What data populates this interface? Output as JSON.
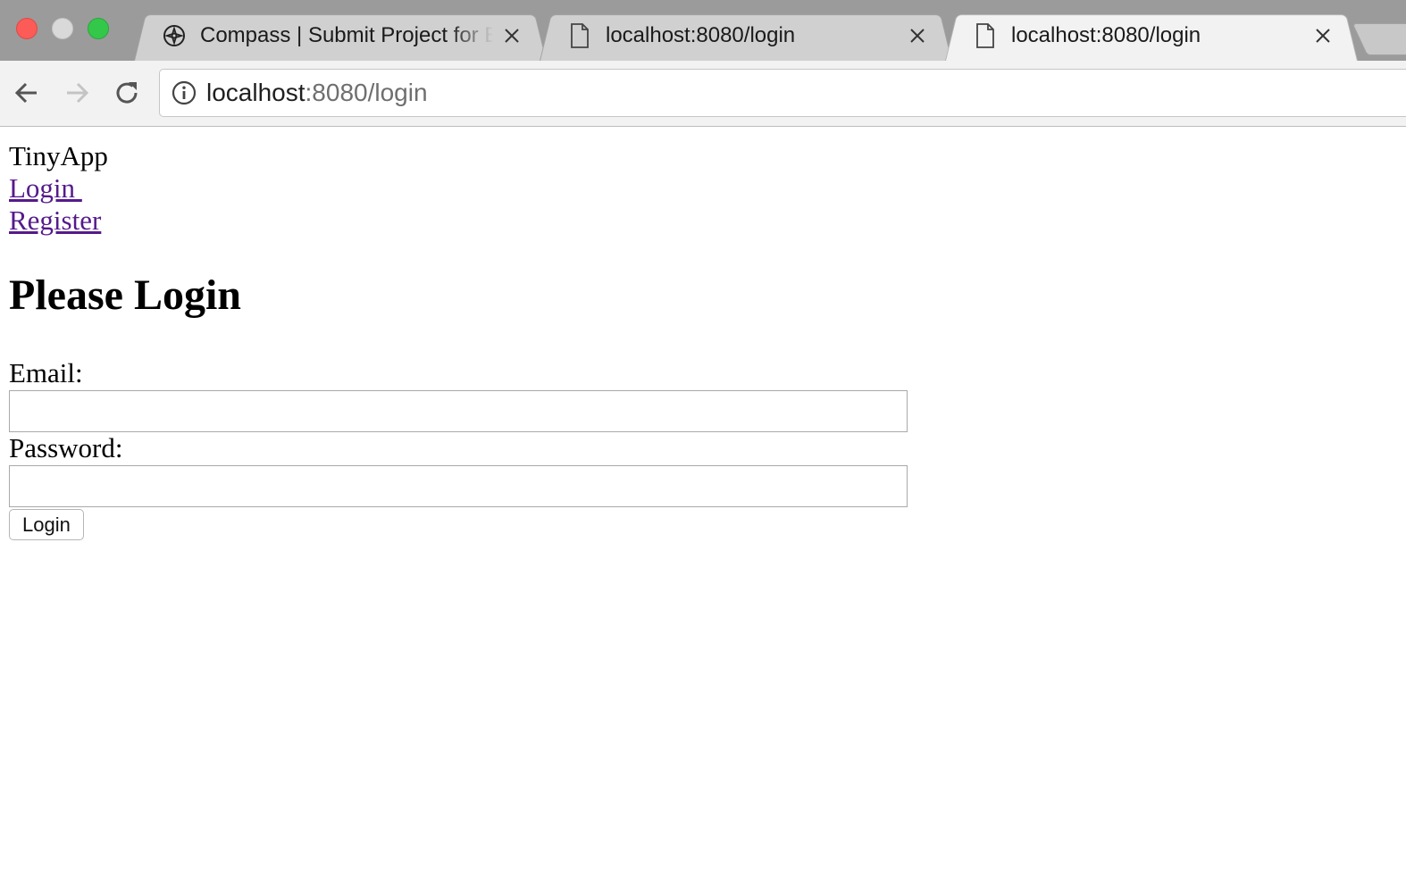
{
  "browser": {
    "tabs": [
      {
        "title": "Compass | Submit Project for E",
        "icon": "compass-icon",
        "active": false
      },
      {
        "title": "localhost:8080/login",
        "icon": "page-icon",
        "active": false
      },
      {
        "title": "localhost:8080/login",
        "icon": "page-icon",
        "active": true
      }
    ],
    "address": {
      "host": "localhost",
      "rest": ":8080/login"
    },
    "colors": {
      "tabbar": "#9b9b9b",
      "active_tab": "#f2f2f2",
      "inactive_tab": "#d0d0d0",
      "close_light": "#fc5b57",
      "max_light": "#34c84a"
    }
  },
  "page": {
    "brand": "TinyApp",
    "nav": {
      "login_link": "Login ",
      "register_link": "Register"
    },
    "heading": "Please Login",
    "form": {
      "email_label": "Email:",
      "email_value": "",
      "password_label": "Password:",
      "password_value": "",
      "submit_label": "Login"
    },
    "colors": {
      "visited_link": "#551a8b"
    }
  }
}
